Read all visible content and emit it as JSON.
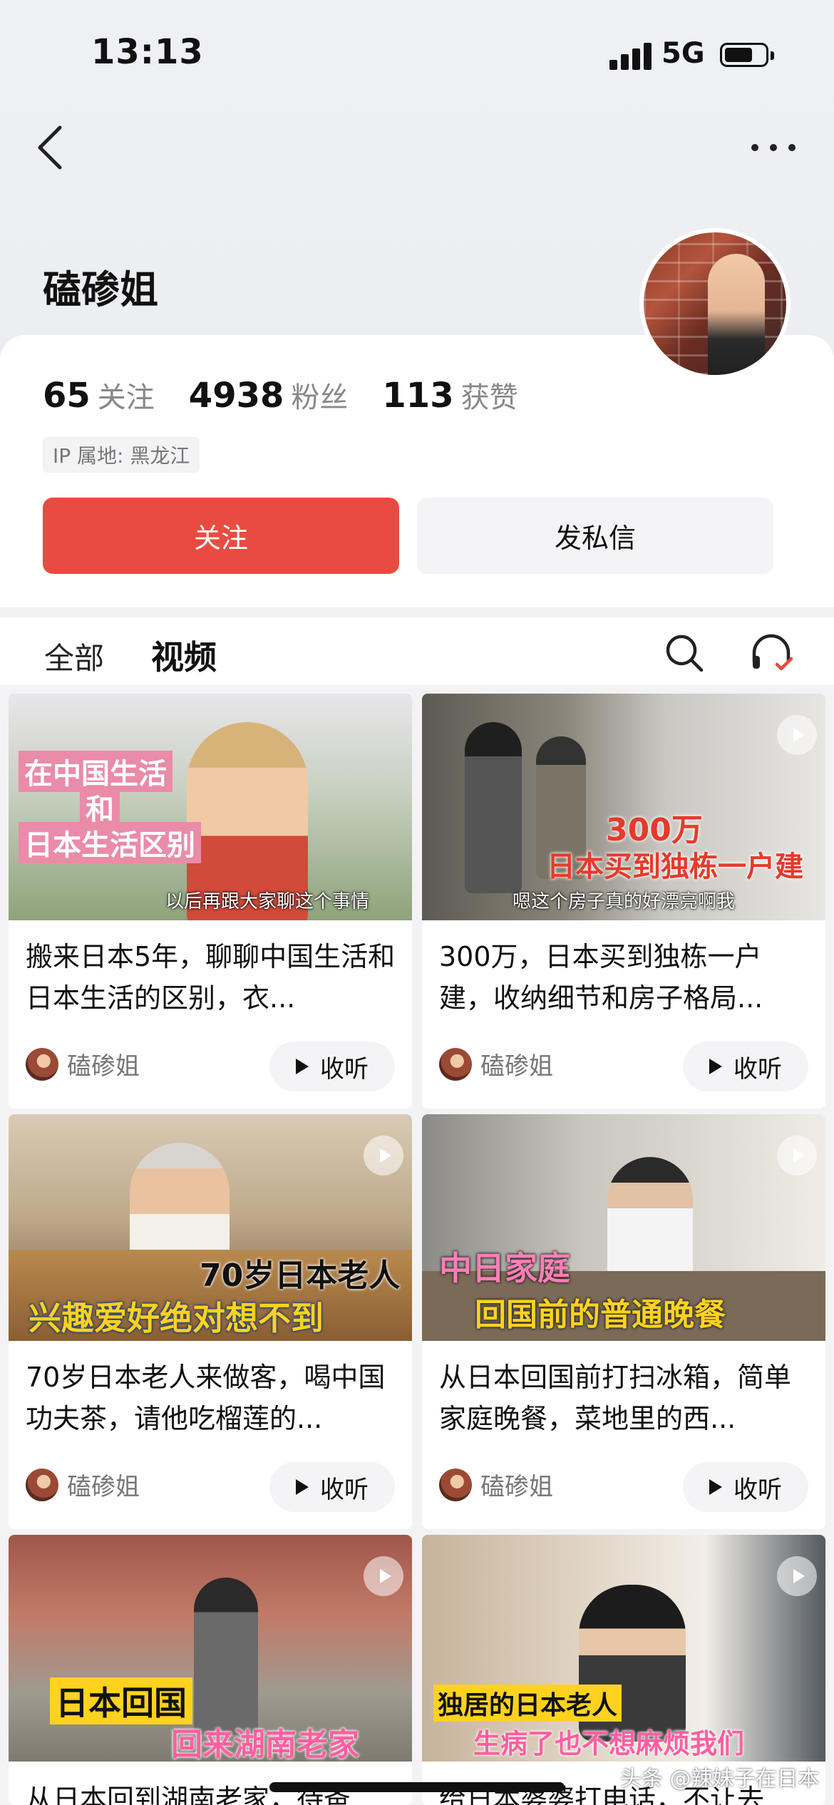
{
  "status_bar": {
    "time": "13:13",
    "network": "5G"
  },
  "profile": {
    "name": "磕碜姐",
    "stats": [
      {
        "count": "65",
        "label": "关注"
      },
      {
        "count": "4938",
        "label": "粉丝"
      },
      {
        "count": "113",
        "label": "获赞"
      }
    ],
    "ip_location": "IP 属地: 黑龙江",
    "follow_label": "关注",
    "message_label": "发私信"
  },
  "tabs": {
    "all": "全部",
    "video": "视频"
  },
  "listen_label": "收听",
  "videos": [
    {
      "title": "搬来日本5年，聊聊中国生活和日本生活的区别，衣...",
      "author": "磕碜姐",
      "overlay": [
        "在中国生活",
        "和",
        "日本生活区别"
      ],
      "subtitle": "以后再跟大家聊这个事情"
    },
    {
      "title": "300万，日本买到独栋一户建，收纳细节和房子格局...",
      "author": "磕碜姐",
      "overlay": [
        "300万",
        "日本买到独栋一户建"
      ],
      "subtitle": "嗯这个房子真的好漂亮啊我"
    },
    {
      "title": "70岁日本老人来做客，喝中国功夫茶，请他吃榴莲的...",
      "author": "磕碜姐",
      "overlay": [
        "70岁日本老人",
        "兴趣爱好绝对想不到"
      ]
    },
    {
      "title": "从日本回国前打扫冰箱，简单家庭晚餐，菜地里的西...",
      "author": "磕碜姐",
      "overlay": [
        "中日家庭",
        "回国前的普通晚餐"
      ]
    },
    {
      "title": "从日本回到湖南老家，待爸...",
      "overlay": [
        "日本回国",
        "回来湖南老家"
      ]
    },
    {
      "title": "给日本婆婆打电话，不让去...",
      "overlay": [
        "独居的日本老人",
        "生病了也不想麻烦我们"
      ]
    }
  ],
  "watermark": "头条 @辣妹子在日本"
}
